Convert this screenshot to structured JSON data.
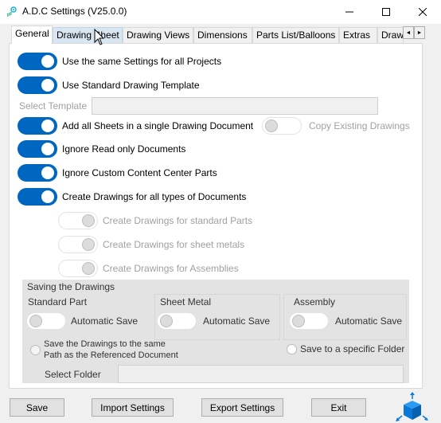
{
  "window": {
    "title": "A.D.C Settings (V25.0.0)",
    "icons": {
      "app": "adc-app-icon",
      "minimize": "minimize-icon",
      "maximize": "maximize-icon",
      "close": "close-icon"
    }
  },
  "tabs": [
    {
      "label": "General",
      "active": true
    },
    {
      "label": "Drawing Sheet",
      "hover": true
    },
    {
      "label": "Drawing Views"
    },
    {
      "label": "Dimensions"
    },
    {
      "label": "Parts List/Balloons"
    },
    {
      "label": "Extras"
    },
    {
      "label": "Draw"
    }
  ],
  "tab_scroll": {
    "left": "◄",
    "right": "►"
  },
  "general": {
    "toggles": [
      {
        "label": "Use the same Settings for all Projects",
        "on": true
      },
      {
        "label": "Use Standard Drawing Template",
        "on": true
      },
      {
        "label": "Add all Sheets in a single Drawing Document",
        "on": true
      },
      {
        "label": "Ignore Read only Documents",
        "on": true
      },
      {
        "label": "Ignore Custom Content Center Parts",
        "on": true
      },
      {
        "label": "Create Drawings for all types of Documents",
        "on": true
      }
    ],
    "select_template": {
      "label": "Select Template",
      "value": ""
    },
    "copy_existing": {
      "label": "Copy Existing Drawings",
      "on": false,
      "enabled": false
    },
    "sub_toggles": [
      {
        "label": "Create Drawings for standard Parts",
        "on": false,
        "enabled": false
      },
      {
        "label": "Create Drawings for sheet metals",
        "on": false,
        "enabled": false
      },
      {
        "label": "Create Drawings for Assemblies",
        "on": false,
        "enabled": false
      }
    ]
  },
  "saving": {
    "title": "Saving the Drawings",
    "groups": [
      {
        "title": "Standard Part",
        "toggle_label": "Automatic Save",
        "on": false
      },
      {
        "title": "Sheet Metal",
        "toggle_label": "Automatic Save",
        "on": false
      },
      {
        "title": "Assembly",
        "toggle_label": "Automatic Save",
        "on": false
      }
    ],
    "radio_same_path": {
      "line1": "Save the Drawings to the same",
      "line2": "Path as the Referenced Document",
      "selected": false
    },
    "radio_specific": {
      "label": "Save to a specific Folder",
      "selected": false
    },
    "select_folder": {
      "label": "Select Folder",
      "value": ""
    }
  },
  "buttons": {
    "save": "Save",
    "import": "Import Settings",
    "export": "Export Settings",
    "exit": "Exit"
  },
  "colors": {
    "accent": "#0067c0",
    "logo": "#0a78d7"
  }
}
